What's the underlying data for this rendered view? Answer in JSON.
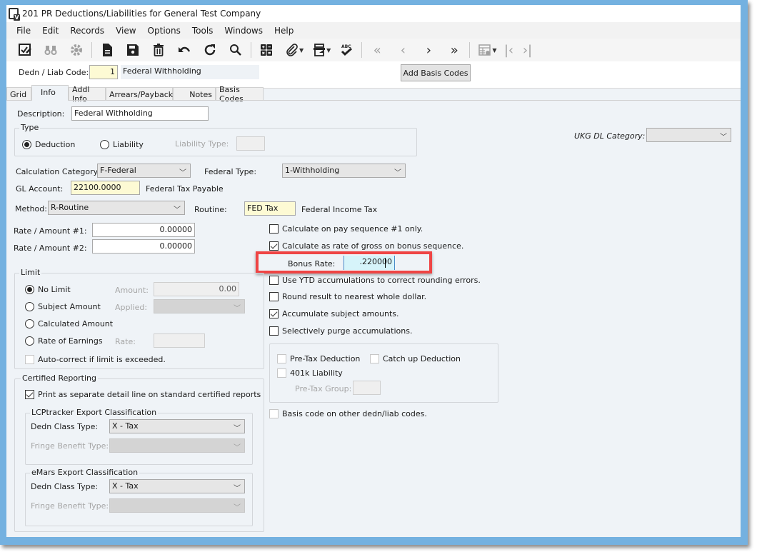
{
  "window": {
    "title": "201 PR Deductions/Liabilities for General Test Company"
  },
  "menu": [
    "File",
    "Edit",
    "Records",
    "View",
    "Options",
    "Tools",
    "Windows",
    "Help"
  ],
  "toolbar": {
    "icons": [
      {
        "name": "edit-checklist-icon",
        "enabled": true
      },
      {
        "name": "binoculars-icon",
        "enabled": false
      },
      {
        "name": "settings-gear-icon",
        "enabled": false
      },
      {
        "name": "new-document-icon",
        "enabled": true
      },
      {
        "name": "save-icon",
        "enabled": true
      },
      {
        "name": "delete-trash-icon",
        "enabled": true
      },
      {
        "name": "undo-icon",
        "enabled": true
      },
      {
        "name": "refresh-icon",
        "enabled": true
      },
      {
        "name": "search-icon",
        "enabled": true
      },
      {
        "name": "calculator-icon",
        "enabled": true
      },
      {
        "name": "attachment-paperclip-icon",
        "enabled": true
      },
      {
        "name": "print-icon",
        "enabled": true
      },
      {
        "name": "spellcheck-icon",
        "enabled": true
      },
      {
        "name": "first-record-icon",
        "enabled": false
      },
      {
        "name": "previous-record-icon",
        "enabled": false
      },
      {
        "name": "next-record-icon",
        "enabled": true
      },
      {
        "name": "last-record-icon",
        "enabled": true
      },
      {
        "name": "grid-settings-icon",
        "enabled": false
      },
      {
        "name": "first-page-icon",
        "enabled": false
      },
      {
        "name": "last-page-icon",
        "enabled": false
      }
    ]
  },
  "header": {
    "code_label": "Dedn / Liab Code:",
    "code_value": "1",
    "code_description": "Federal Withholding",
    "add_basis_button": "Add Basis Codes"
  },
  "tabs": [
    {
      "label": "Grid",
      "active": false
    },
    {
      "label": "Info",
      "active": true
    },
    {
      "label": "Addl Info",
      "active": false
    },
    {
      "label": "Arrears/Payback",
      "active": false
    },
    {
      "label": "Notes",
      "active": false
    },
    {
      "label": "Basis Codes",
      "active": false
    }
  ],
  "info": {
    "description_label": "Description:",
    "description_value": "Federal Withholding",
    "type_group": "Type",
    "type_deduction": "Deduction",
    "type_liability": "Liability",
    "type_selected": "Deduction",
    "liability_type_label": "Liability Type:",
    "liability_type_value": "",
    "ukg_label": "UKG DL Category:",
    "ukg_value": "",
    "calc_category_label": "Calculation Category:",
    "calc_category_value": "F-Federal",
    "federal_type_label": "Federal Type:",
    "federal_type_value": "1-Withholding",
    "gl_account_label": "GL Account:",
    "gl_account_value": "22100.0000",
    "gl_account_description": "Federal Tax Payable",
    "method_label": "Method:",
    "method_value": "R-Routine",
    "routine_label": "Routine:",
    "routine_value": "FED Tax",
    "routine_description": "Federal Income Tax",
    "rate1_label": "Rate / Amount #1:",
    "rate1_value": "0.00000",
    "rate2_label": "Rate / Amount #2:",
    "rate2_value": "0.00000"
  },
  "options": {
    "calc_seq1": {
      "label": "Calculate on pay sequence #1 only.",
      "checked": false
    },
    "calc_bonus": {
      "label": "Calculate as rate of gross on bonus sequence.",
      "checked": true
    },
    "bonus_rate_label": "Bonus Rate:",
    "bonus_rate_value": ".220000",
    "use_ytd": {
      "label": "Use YTD accumulations to correct rounding errors.",
      "checked": false
    },
    "round_dollar": {
      "label": "Round result to nearest whole dollar.",
      "checked": false
    },
    "accumulate": {
      "label": "Accumulate subject amounts.",
      "checked": true
    },
    "purge": {
      "label": "Selectively purge accumulations.",
      "checked": false
    },
    "pretax": {
      "label": "Pre-Tax Deduction",
      "checked": false
    },
    "catchup": {
      "label": "Catch up Deduction",
      "checked": false
    },
    "liability401k": {
      "label": "401k Liability",
      "checked": false
    },
    "pretax_group_label": "Pre-Tax Group:",
    "pretax_group_value": "",
    "basis_other": {
      "label": "Basis code on other dedn/liab codes.",
      "checked": false
    }
  },
  "limit": {
    "group": "Limit",
    "no_limit": "No Limit",
    "subject_amount": "Subject Amount",
    "calculated_amount": "Calculated Amount",
    "rate_of_earnings": "Rate of Earnings",
    "selected": "No Limit",
    "amount_label": "Amount:",
    "amount_value": "0.00",
    "applied_label": "Applied:",
    "applied_value": "",
    "rate_label": "Rate:",
    "rate_value": "",
    "autocorrect": {
      "label": "Auto-correct if limit is exceeded.",
      "checked": false
    }
  },
  "certified": {
    "group": "Certified Reporting",
    "print_separate": {
      "label": "Print as separate detail line on standard certified reports",
      "checked": true
    },
    "lcp_group": "LCPtracker Export Classification",
    "lcp_class_label": "Dedn Class Type:",
    "lcp_class_value": "X - Tax",
    "lcp_fringe_label": "Fringe Benefit Type:",
    "lcp_fringe_value": "",
    "emars_group": "eMars Export Classification",
    "emars_class_label": "Dedn Class Type:",
    "emars_class_value": "X - Tax",
    "emars_fringe_label": "Fringe Benefit Type:",
    "emars_fringe_value": ""
  },
  "colors": {
    "frame": "#74b1e0",
    "highlight": "#ef4444",
    "required_field": "#fdfad4",
    "focused_field": "#d6f4fa"
  }
}
